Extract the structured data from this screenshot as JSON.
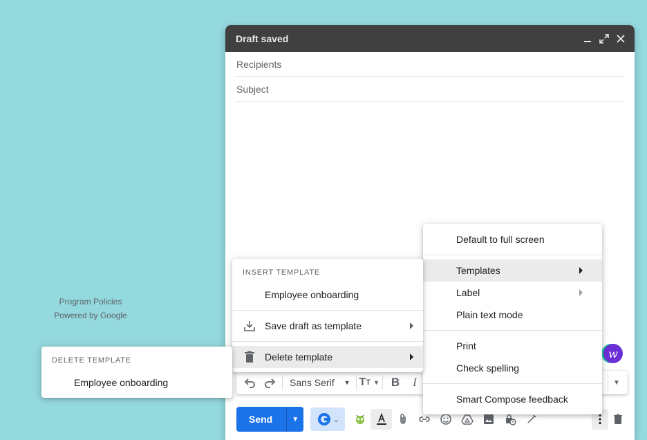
{
  "footer": {
    "program_policies": "Program Policies",
    "powered_by": "Powered by Google"
  },
  "compose": {
    "title": "Draft saved",
    "header_icons": [
      "minimize-icon",
      "fullscreen-icon",
      "close-icon"
    ],
    "recipients_placeholder": "Recipients",
    "subject_placeholder": "Subject"
  },
  "format_bar": {
    "font": "Sans Serif",
    "icons": [
      "undo-icon",
      "redo-icon",
      "font-dropdown",
      "text-size-icon",
      "bold-icon",
      "italic-icon"
    ]
  },
  "bottom_bar": {
    "send_label": "Send",
    "accent": "#1a73e8",
    "tools": [
      "extension-icon",
      "bug-icon",
      "text-format-icon",
      "attach-icon",
      "link-icon",
      "emoji-icon",
      "drive-icon",
      "photo-icon",
      "confidential-icon",
      "signature-icon",
      "more-options-icon",
      "trash-icon"
    ]
  },
  "more_menu": {
    "items": [
      {
        "label": "Default to full screen"
      },
      {
        "label": "Templates"
      },
      {
        "label": "Label"
      },
      {
        "label": "Plain text mode"
      },
      {
        "label": "Print"
      },
      {
        "label": "Check spelling"
      },
      {
        "label": "Smart Compose feedback"
      }
    ]
  },
  "template_menu": {
    "header": "INSERT TEMPLATE",
    "insert_item": "Employee onboarding",
    "save_label": "Save draft as template",
    "delete_label": "Delete template"
  },
  "delete_menu": {
    "header": "DELETE TEMPLATE",
    "item": "Employee onboarding"
  },
  "grammarly_glyph": "w"
}
